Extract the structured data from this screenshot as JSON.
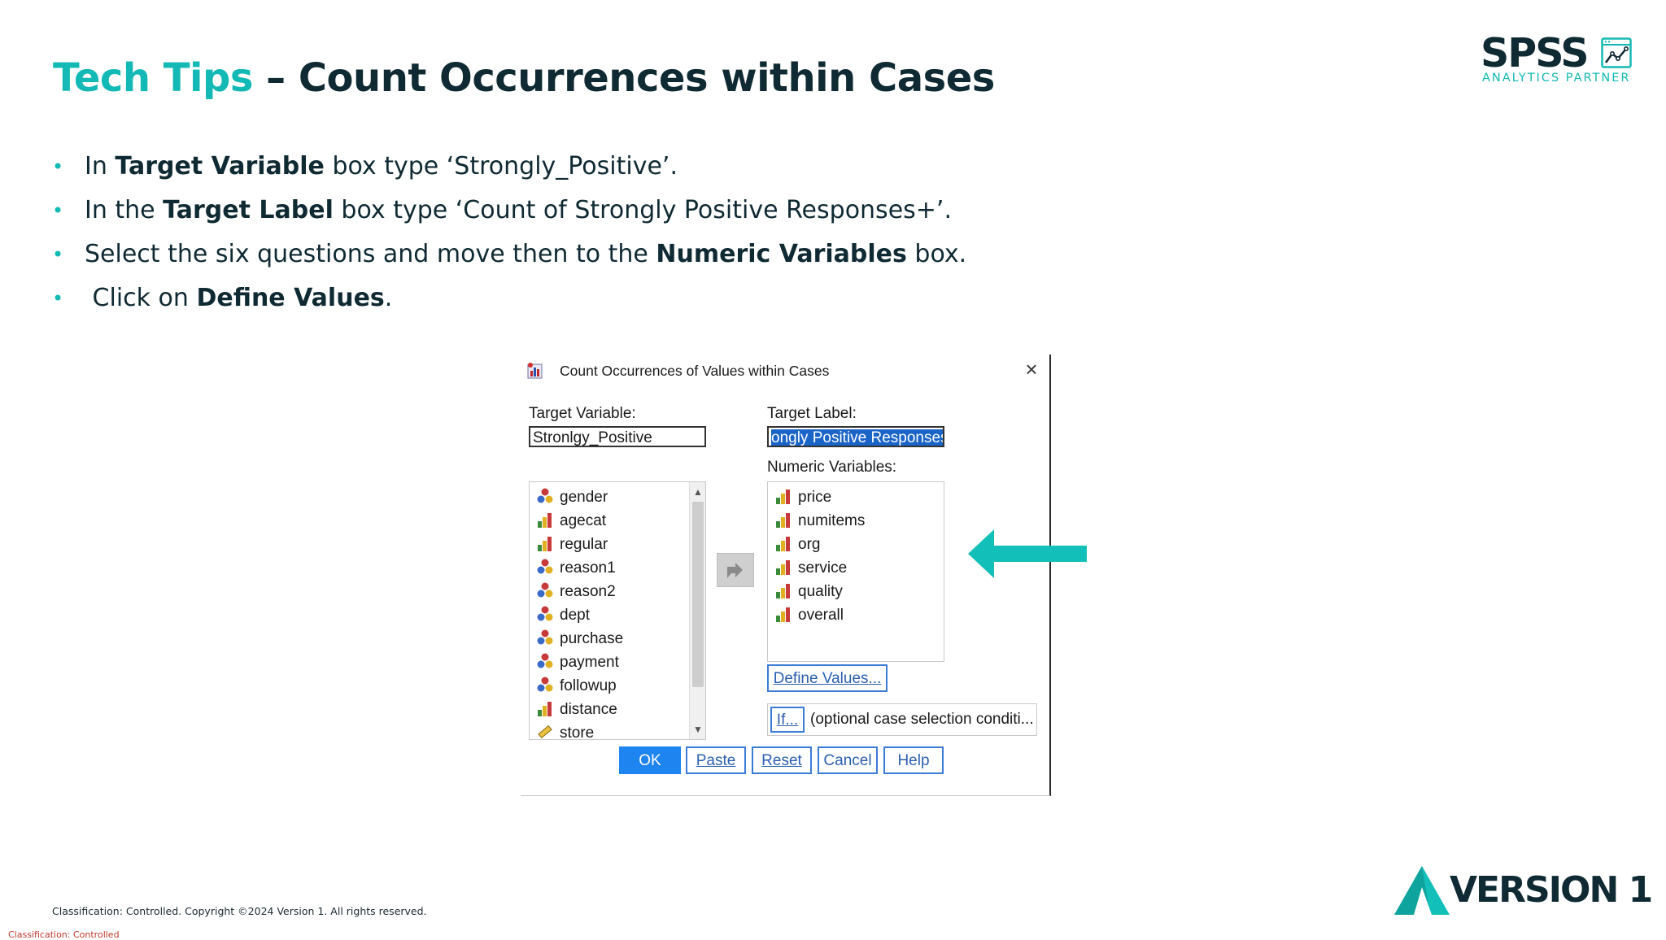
{
  "slide": {
    "title_accent": "Tech Tips",
    "title_rest": " – Count Occurrences within Cases",
    "logo_word": "SPSS",
    "logo_sub": "ANALYTICS PARTNER",
    "bullets": [
      {
        "pre": "In ",
        "bold": "Target Variable",
        "post": " box type ‘Strongly_Positive’."
      },
      {
        "pre": "In the ",
        "bold": "Target Label",
        "post": " box type ‘Count of Strongly Positive Responses+’."
      },
      {
        "pre": "Select the six questions and move then to the ",
        "bold": "Numeric Variables",
        "post": " box."
      },
      {
        "pre": " Click on ",
        "bold": "Define Values",
        "post": "."
      }
    ],
    "accent_color": "#13b9b4",
    "copyright": "Classification: Controlled. Copyright ©2024 Version 1. All rights reserved.",
    "classification": "Classification: Controlled",
    "brand_word": "VERSION 1"
  },
  "dialog": {
    "title": "Count Occurrences of Values within Cases",
    "target_variable_label": "Target Variable:",
    "target_variable_value": "Stronlgy_Positive",
    "target_label_label": "Target Label:",
    "target_label_value": "ongly Positive Responses",
    "numeric_variables_label": "Numeric Variables:",
    "source_variables": [
      {
        "name": "gender",
        "type": "nominal"
      },
      {
        "name": "agecat",
        "type": "ordinal"
      },
      {
        "name": "regular",
        "type": "ordinal"
      },
      {
        "name": "reason1",
        "type": "nominal"
      },
      {
        "name": "reason2",
        "type": "nominal"
      },
      {
        "name": "dept",
        "type": "nominal"
      },
      {
        "name": "purchase",
        "type": "nominal"
      },
      {
        "name": "payment",
        "type": "nominal"
      },
      {
        "name": "followup",
        "type": "nominal"
      },
      {
        "name": "distance",
        "type": "ordinal"
      },
      {
        "name": "store",
        "type": "scale"
      }
    ],
    "numeric_variables": [
      {
        "name": "price",
        "type": "ordinal"
      },
      {
        "name": "numitems",
        "type": "ordinal"
      },
      {
        "name": "org",
        "type": "ordinal"
      },
      {
        "name": "service",
        "type": "ordinal"
      },
      {
        "name": "quality",
        "type": "ordinal"
      },
      {
        "name": "overall",
        "type": "ordinal"
      }
    ],
    "define_values_button": "Define Values...",
    "if_button": "If...",
    "if_text": "(optional case selection conditi...",
    "buttons": {
      "ok": "OK",
      "paste": "Paste",
      "reset": "Reset",
      "cancel": "Cancel",
      "help": "Help"
    }
  }
}
